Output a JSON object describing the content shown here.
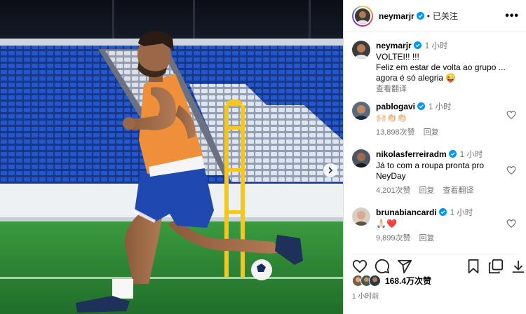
{
  "post": {
    "author": "neymarjr",
    "follow_status": "已关注",
    "more_label": "•••",
    "caption": {
      "username": "neymarjr",
      "time": "1 小时",
      "line1": "VOLTEI!! !!!",
      "line2": "Feliz em estar de volta ao grupo ...",
      "line3": "agora é só alegria 😜",
      "translate": "查看翻译"
    },
    "comments": [
      {
        "username": "pablogavi",
        "time": "1 小时",
        "text": "🙌🏻👏🏻👏🏻",
        "likes": "13,898次赞",
        "reply": "回复",
        "translate": ""
      },
      {
        "username": "nikolasferreiradm",
        "time": "1 小时",
        "text": "Já to com a roupa pronta pro NeyDay",
        "likes": "4,201次赞",
        "reply": "回复",
        "translate": "查看翻译"
      },
      {
        "username": "brunabiancardi",
        "time": "1 小时",
        "text": "🙏🏻❤️",
        "likes": "9,899次赞",
        "reply": "回复",
        "translate": ""
      }
    ],
    "like_count": "168.4万次赞",
    "posted_time": "1 小时前"
  },
  "icons": {
    "like": "heart-icon",
    "comment": "comment-icon",
    "share": "send-icon",
    "save": "bookmark-icon",
    "collection": "copy-icon",
    "download": "download-icon",
    "next": "chevron-right-icon"
  },
  "colors": {
    "verified": "#0095f6",
    "vest": "#f08f3a",
    "shorts": "#1f49b0",
    "pitch": "#2d8a36",
    "seats": "#1f4fb8"
  }
}
